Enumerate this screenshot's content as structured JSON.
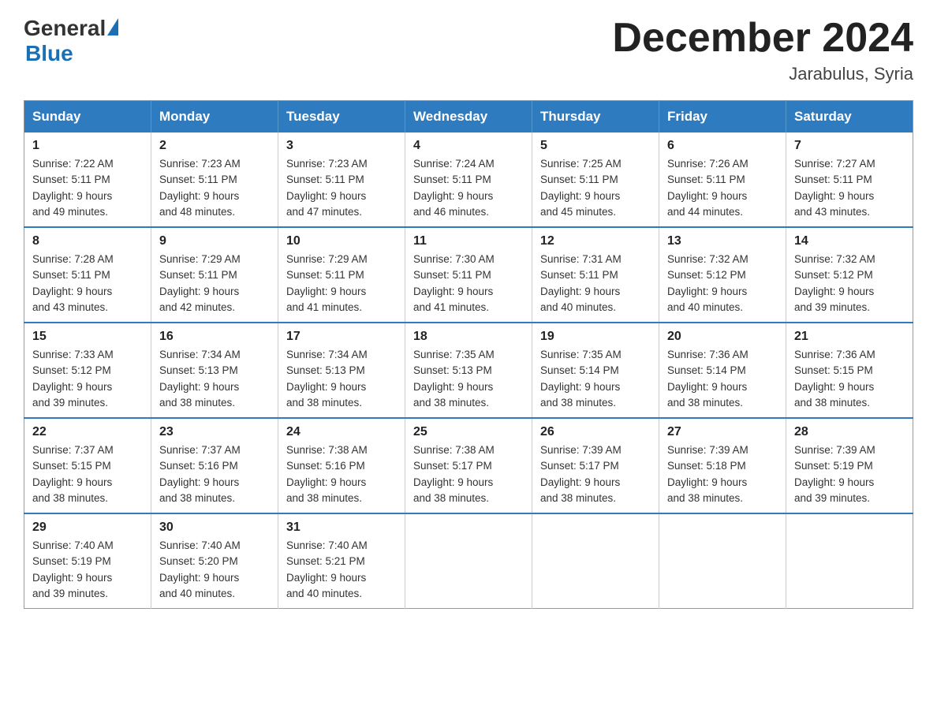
{
  "header": {
    "logo_general": "General",
    "logo_blue": "Blue",
    "month_title": "December 2024",
    "location": "Jarabulus, Syria"
  },
  "days_of_week": [
    "Sunday",
    "Monday",
    "Tuesday",
    "Wednesday",
    "Thursday",
    "Friday",
    "Saturday"
  ],
  "weeks": [
    [
      {
        "day": "1",
        "sunrise": "7:22 AM",
        "sunset": "5:11 PM",
        "daylight": "9 hours and 49 minutes."
      },
      {
        "day": "2",
        "sunrise": "7:23 AM",
        "sunset": "5:11 PM",
        "daylight": "9 hours and 48 minutes."
      },
      {
        "day": "3",
        "sunrise": "7:23 AM",
        "sunset": "5:11 PM",
        "daylight": "9 hours and 47 minutes."
      },
      {
        "day": "4",
        "sunrise": "7:24 AM",
        "sunset": "5:11 PM",
        "daylight": "9 hours and 46 minutes."
      },
      {
        "day": "5",
        "sunrise": "7:25 AM",
        "sunset": "5:11 PM",
        "daylight": "9 hours and 45 minutes."
      },
      {
        "day": "6",
        "sunrise": "7:26 AM",
        "sunset": "5:11 PM",
        "daylight": "9 hours and 44 minutes."
      },
      {
        "day": "7",
        "sunrise": "7:27 AM",
        "sunset": "5:11 PM",
        "daylight": "9 hours and 43 minutes."
      }
    ],
    [
      {
        "day": "8",
        "sunrise": "7:28 AM",
        "sunset": "5:11 PM",
        "daylight": "9 hours and 43 minutes."
      },
      {
        "day": "9",
        "sunrise": "7:29 AM",
        "sunset": "5:11 PM",
        "daylight": "9 hours and 42 minutes."
      },
      {
        "day": "10",
        "sunrise": "7:29 AM",
        "sunset": "5:11 PM",
        "daylight": "9 hours and 41 minutes."
      },
      {
        "day": "11",
        "sunrise": "7:30 AM",
        "sunset": "5:11 PM",
        "daylight": "9 hours and 41 minutes."
      },
      {
        "day": "12",
        "sunrise": "7:31 AM",
        "sunset": "5:11 PM",
        "daylight": "9 hours and 40 minutes."
      },
      {
        "day": "13",
        "sunrise": "7:32 AM",
        "sunset": "5:12 PM",
        "daylight": "9 hours and 40 minutes."
      },
      {
        "day": "14",
        "sunrise": "7:32 AM",
        "sunset": "5:12 PM",
        "daylight": "9 hours and 39 minutes."
      }
    ],
    [
      {
        "day": "15",
        "sunrise": "7:33 AM",
        "sunset": "5:12 PM",
        "daylight": "9 hours and 39 minutes."
      },
      {
        "day": "16",
        "sunrise": "7:34 AM",
        "sunset": "5:13 PM",
        "daylight": "9 hours and 38 minutes."
      },
      {
        "day": "17",
        "sunrise": "7:34 AM",
        "sunset": "5:13 PM",
        "daylight": "9 hours and 38 minutes."
      },
      {
        "day": "18",
        "sunrise": "7:35 AM",
        "sunset": "5:13 PM",
        "daylight": "9 hours and 38 minutes."
      },
      {
        "day": "19",
        "sunrise": "7:35 AM",
        "sunset": "5:14 PM",
        "daylight": "9 hours and 38 minutes."
      },
      {
        "day": "20",
        "sunrise": "7:36 AM",
        "sunset": "5:14 PM",
        "daylight": "9 hours and 38 minutes."
      },
      {
        "day": "21",
        "sunrise": "7:36 AM",
        "sunset": "5:15 PM",
        "daylight": "9 hours and 38 minutes."
      }
    ],
    [
      {
        "day": "22",
        "sunrise": "7:37 AM",
        "sunset": "5:15 PM",
        "daylight": "9 hours and 38 minutes."
      },
      {
        "day": "23",
        "sunrise": "7:37 AM",
        "sunset": "5:16 PM",
        "daylight": "9 hours and 38 minutes."
      },
      {
        "day": "24",
        "sunrise": "7:38 AM",
        "sunset": "5:16 PM",
        "daylight": "9 hours and 38 minutes."
      },
      {
        "day": "25",
        "sunrise": "7:38 AM",
        "sunset": "5:17 PM",
        "daylight": "9 hours and 38 minutes."
      },
      {
        "day": "26",
        "sunrise": "7:39 AM",
        "sunset": "5:17 PM",
        "daylight": "9 hours and 38 minutes."
      },
      {
        "day": "27",
        "sunrise": "7:39 AM",
        "sunset": "5:18 PM",
        "daylight": "9 hours and 38 minutes."
      },
      {
        "day": "28",
        "sunrise": "7:39 AM",
        "sunset": "5:19 PM",
        "daylight": "9 hours and 39 minutes."
      }
    ],
    [
      {
        "day": "29",
        "sunrise": "7:40 AM",
        "sunset": "5:19 PM",
        "daylight": "9 hours and 39 minutes."
      },
      {
        "day": "30",
        "sunrise": "7:40 AM",
        "sunset": "5:20 PM",
        "daylight": "9 hours and 40 minutes."
      },
      {
        "day": "31",
        "sunrise": "7:40 AM",
        "sunset": "5:21 PM",
        "daylight": "9 hours and 40 minutes."
      },
      null,
      null,
      null,
      null
    ]
  ],
  "labels": {
    "sunrise_prefix": "Sunrise: ",
    "sunset_prefix": "Sunset: ",
    "daylight_prefix": "Daylight: "
  }
}
